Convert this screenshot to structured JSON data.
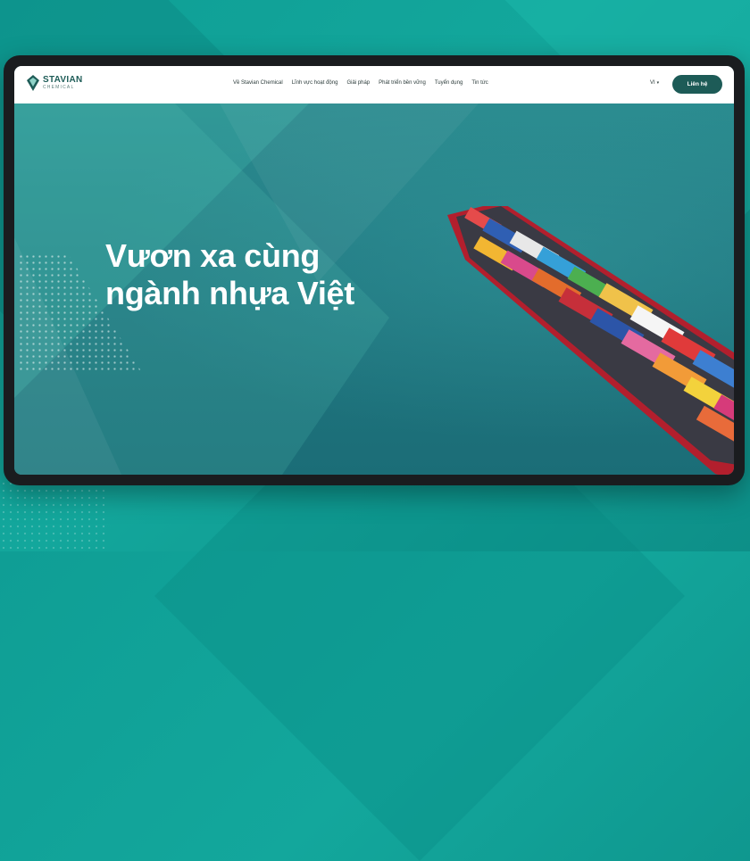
{
  "brand": {
    "name": "STAVIAN",
    "sub": "CHEMICAL"
  },
  "nav": {
    "items": [
      {
        "label": "Về Stavian Chemical"
      },
      {
        "label": "Lĩnh vực hoạt động"
      },
      {
        "label": "Giải pháp"
      },
      {
        "label": "Phát triển bền vững"
      },
      {
        "label": "Tuyển dụng"
      },
      {
        "label": "Tin tức"
      }
    ]
  },
  "lang": {
    "current": "VI"
  },
  "contact": {
    "label": "Liên hệ"
  },
  "hero": {
    "title_line1": "Vươn xa cùng",
    "title_line2": "ngành nhựa Việt"
  },
  "slider": {
    "count": 3,
    "active": 1
  },
  "colors": {
    "brand": "#1d5b57",
    "background": "#13a79c",
    "frame": "#1a1c1f"
  }
}
